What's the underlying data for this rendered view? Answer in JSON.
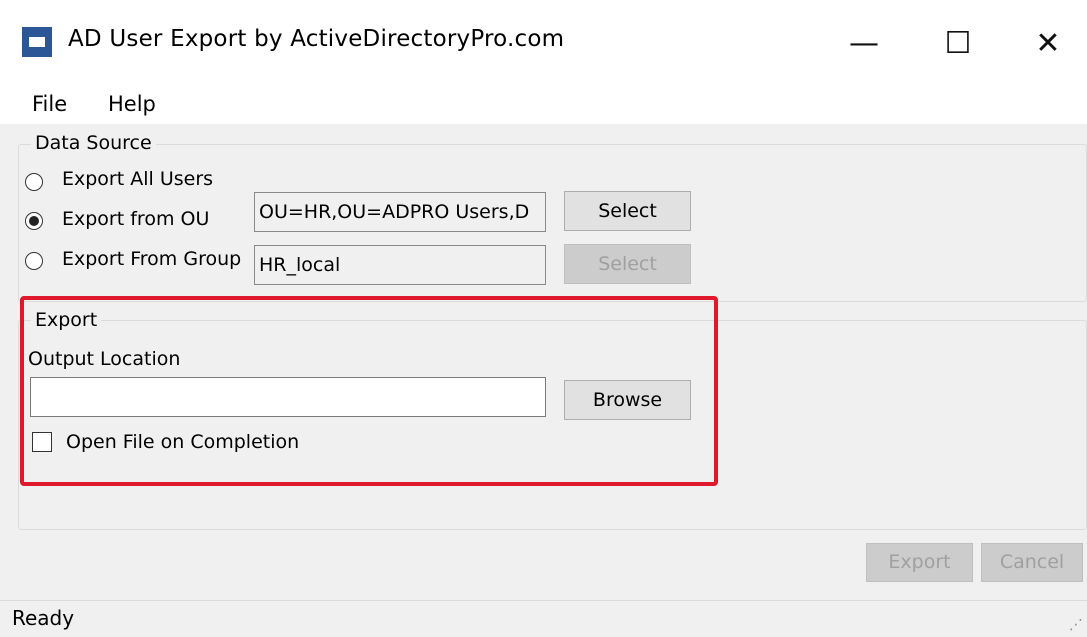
{
  "window": {
    "title": "AD User Export by ActiveDirectoryPro.com",
    "controls": {
      "minimize": "—",
      "maximize": "☐",
      "close": "✕"
    }
  },
  "menu": [
    "File",
    "Help"
  ],
  "data_source": {
    "legend": "Data Source",
    "options": [
      {
        "label": "Export All Users",
        "selected": false
      },
      {
        "label": "Export from OU",
        "selected": true
      },
      {
        "label": "Export From Group",
        "selected": false
      }
    ],
    "ou_value": "OU=HR,OU=ADPRO Users,D",
    "group_value": "HR_local",
    "select_label": "Select",
    "select_group_label": "Select"
  },
  "export": {
    "legend": "Export",
    "output_location_label": "Output Location",
    "output_location_value": "",
    "browse_label": "Browse",
    "open_on_completion_label": "Open File on Completion",
    "open_on_completion_checked": false
  },
  "actions": {
    "export_label": "Export",
    "cancel_label": "Cancel"
  },
  "status": {
    "text": "Ready",
    "grip": "⋰"
  },
  "colors": {
    "highlight": "#e0182b",
    "form_bg": "#f0f0f0",
    "icon": "#2b5797"
  }
}
